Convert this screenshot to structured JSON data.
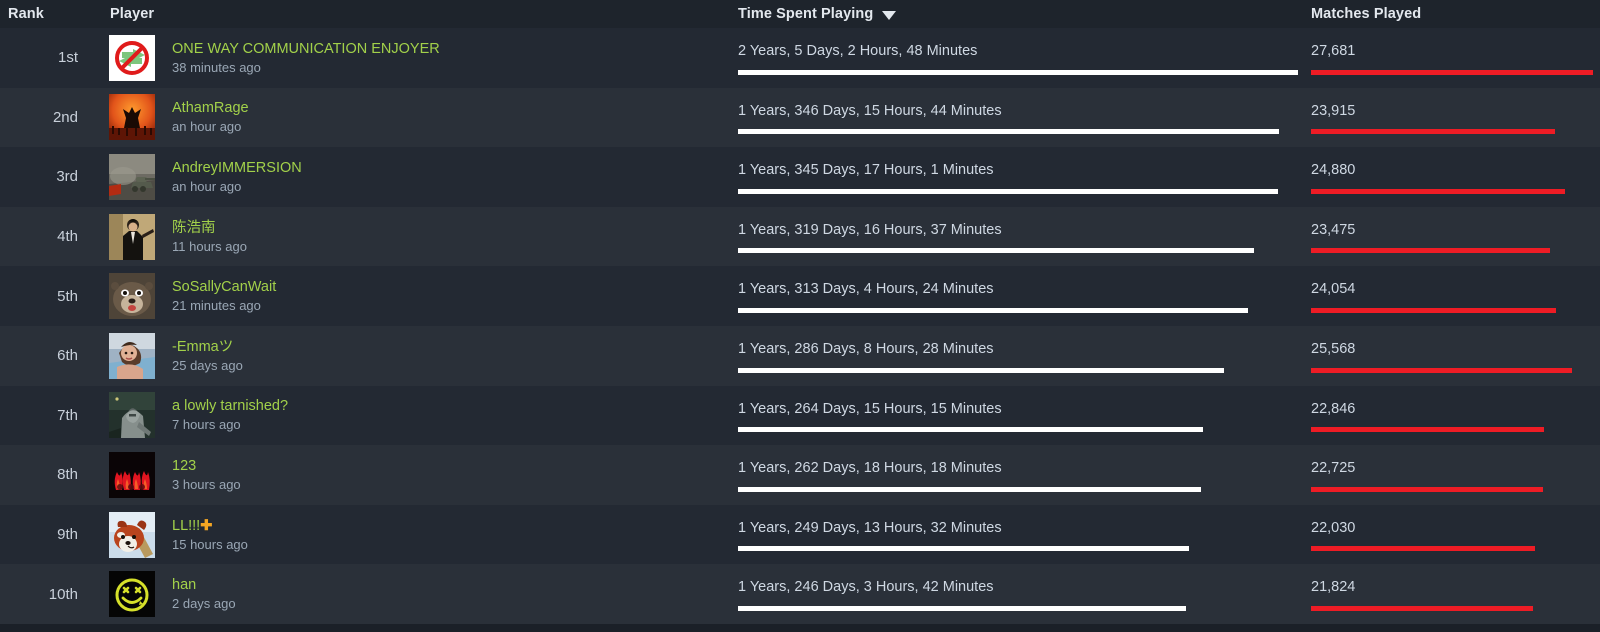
{
  "header": {
    "rank": "Rank",
    "player": "Player",
    "time": "Time Spent Playing",
    "matches": "Matches Played",
    "sort_icon": "caret-down-icon",
    "sorted_column": "Time Spent Playing",
    "sort_direction": "descending"
  },
  "colors": {
    "header_bg": "#1e242c",
    "row_bg_odd": "#232933",
    "row_bg_even": "#2a3039",
    "player_name": "#a2d14a",
    "time_bar": "#ffffff",
    "matches_bar": "#ee1c25",
    "muted_text": "#9aa7b5",
    "value_text": "#cfd8e3"
  },
  "rows": [
    {
      "rank": "1st",
      "name": "ONE WAY COMMUNICATION ENJOYER",
      "name_suffix": "",
      "last_seen": "38 minutes ago",
      "avatar": "no-communication-icon",
      "time": "2 Years, 5 Days, 2 Hours, 48 Minutes",
      "time_bar_pct": 100,
      "matches": "27,681",
      "matches_bar_pct": 100
    },
    {
      "rank": "2nd",
      "name": "AthamRage",
      "name_suffix": "",
      "last_seen": "an hour ago",
      "avatar": "sunset-silhouette-icon",
      "time": "1 Years, 346 Days, 15 Hours, 44 Minutes",
      "time_bar_pct": 96.6,
      "matches": "23,915",
      "matches_bar_pct": 86.4
    },
    {
      "rank": "3rd",
      "name": "AndreyIMMERSION",
      "name_suffix": "",
      "last_seen": "an hour ago",
      "avatar": "tank-battle-icon",
      "time": "1 Years, 345 Days, 17 Hours, 1 Minutes",
      "time_bar_pct": 96.4,
      "matches": "24,880",
      "matches_bar_pct": 89.9
    },
    {
      "rank": "4th",
      "name": "陈浩南",
      "name_suffix": "",
      "last_seen": "11 hours ago",
      "avatar": "man-in-suit-icon",
      "time": "1 Years, 319 Days, 16 Hours, 37 Minutes",
      "time_bar_pct": 92.1,
      "matches": "23,475",
      "matches_bar_pct": 84.8
    },
    {
      "rank": "5th",
      "name": "SoSallyCanWait",
      "name_suffix": "",
      "last_seen": "21 minutes ago",
      "avatar": "otter-icon",
      "time": "1 Years, 313 Days, 4 Hours, 24 Minutes",
      "time_bar_pct": 91.1,
      "matches": "24,054",
      "matches_bar_pct": 86.9
    },
    {
      "rank": "6th",
      "name": "-Emmaツ",
      "name_suffix": "",
      "last_seen": "25 days ago",
      "avatar": "woman-portrait-icon",
      "time": "1 Years, 286 Days, 8 Hours, 28 Minutes",
      "time_bar_pct": 86.7,
      "matches": "25,568",
      "matches_bar_pct": 92.4
    },
    {
      "rank": "7th",
      "name": "a lowly tarnished?",
      "name_suffix": "",
      "last_seen": "7 hours ago",
      "avatar": "knight-statue-icon",
      "time": "1 Years, 264 Days, 15 Hours, 15 Minutes",
      "time_bar_pct": 83.0,
      "matches": "22,846",
      "matches_bar_pct": 82.5
    },
    {
      "rank": "8th",
      "name": "123",
      "name_suffix": "",
      "last_seen": "3 hours ago",
      "avatar": "red-flames-icon",
      "time": "1 Years, 262 Days, 18 Hours, 18 Minutes",
      "time_bar_pct": 82.7,
      "matches": "22,725",
      "matches_bar_pct": 82.1
    },
    {
      "rank": "9th",
      "name": "LL!!!",
      "name_suffix": "✚",
      "last_seen": "15 hours ago",
      "avatar": "red-panda-icon",
      "time": "1 Years, 249 Days, 13 Hours, 32 Minutes",
      "time_bar_pct": 80.5,
      "matches": "22,030",
      "matches_bar_pct": 79.6
    },
    {
      "rank": "10th",
      "name": "han",
      "name_suffix": "",
      "last_seen": "2 days ago",
      "avatar": "smiley-face-icon",
      "time": "1 Years, 246 Days, 3 Hours, 42 Minutes",
      "time_bar_pct": 80.0,
      "matches": "21,824",
      "matches_bar_pct": 78.8
    }
  ]
}
